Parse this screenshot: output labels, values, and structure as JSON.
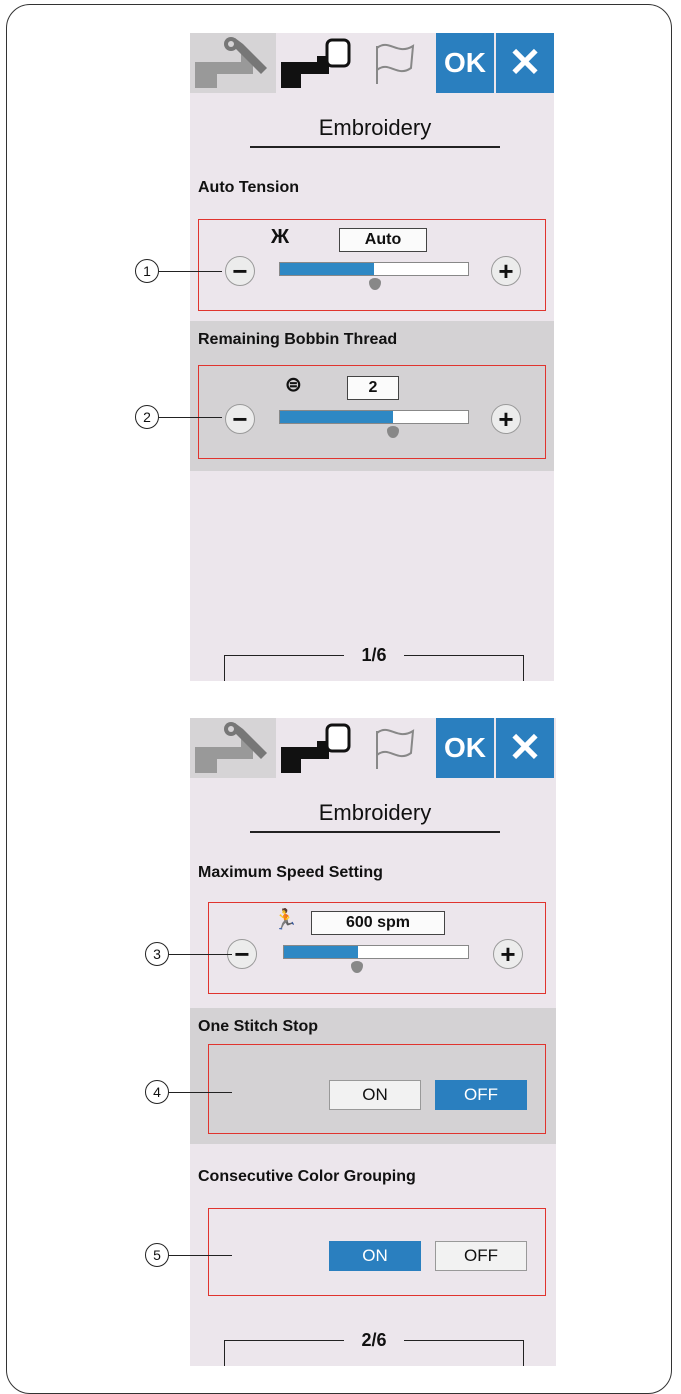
{
  "screens": [
    {
      "tabs": {
        "ok_label": "OK",
        "close_label": "✕"
      },
      "title": "Embroidery",
      "sections": [
        {
          "label": "Auto Tension",
          "value": "Auto",
          "slider_fraction": 0.5,
          "callout": "1"
        },
        {
          "label": "Remaining Bobbin Thread",
          "value": "2",
          "slider_fraction": 0.6,
          "callout": "2"
        }
      ],
      "page_indicator": "1/6"
    },
    {
      "tabs": {
        "ok_label": "OK",
        "close_label": "✕"
      },
      "title": "Embroidery",
      "sections": [
        {
          "label": "Maximum Speed Setting",
          "value": "600 spm",
          "slider_fraction": 0.4,
          "callout": "3"
        },
        {
          "label": "One Stitch Stop",
          "on_label": "ON",
          "off_label": "OFF",
          "selected": "OFF",
          "callout": "4"
        },
        {
          "label": "Consecutive Color Grouping",
          "on_label": "ON",
          "off_label": "OFF",
          "selected": "ON",
          "callout": "5"
        }
      ],
      "page_indicator": "2/6"
    }
  ],
  "controls": {
    "minus_label": "−",
    "plus_label": "+"
  },
  "icons": [
    "wrench-machine-icon",
    "embroidery-machine-icon",
    "flag-icon",
    "tension-icon",
    "bobbin-icon",
    "running-speed-icon"
  ],
  "colors": {
    "accent": "#2a7fbf",
    "highlight_box": "#e0342e",
    "screen_bg": "#ece6ec"
  }
}
